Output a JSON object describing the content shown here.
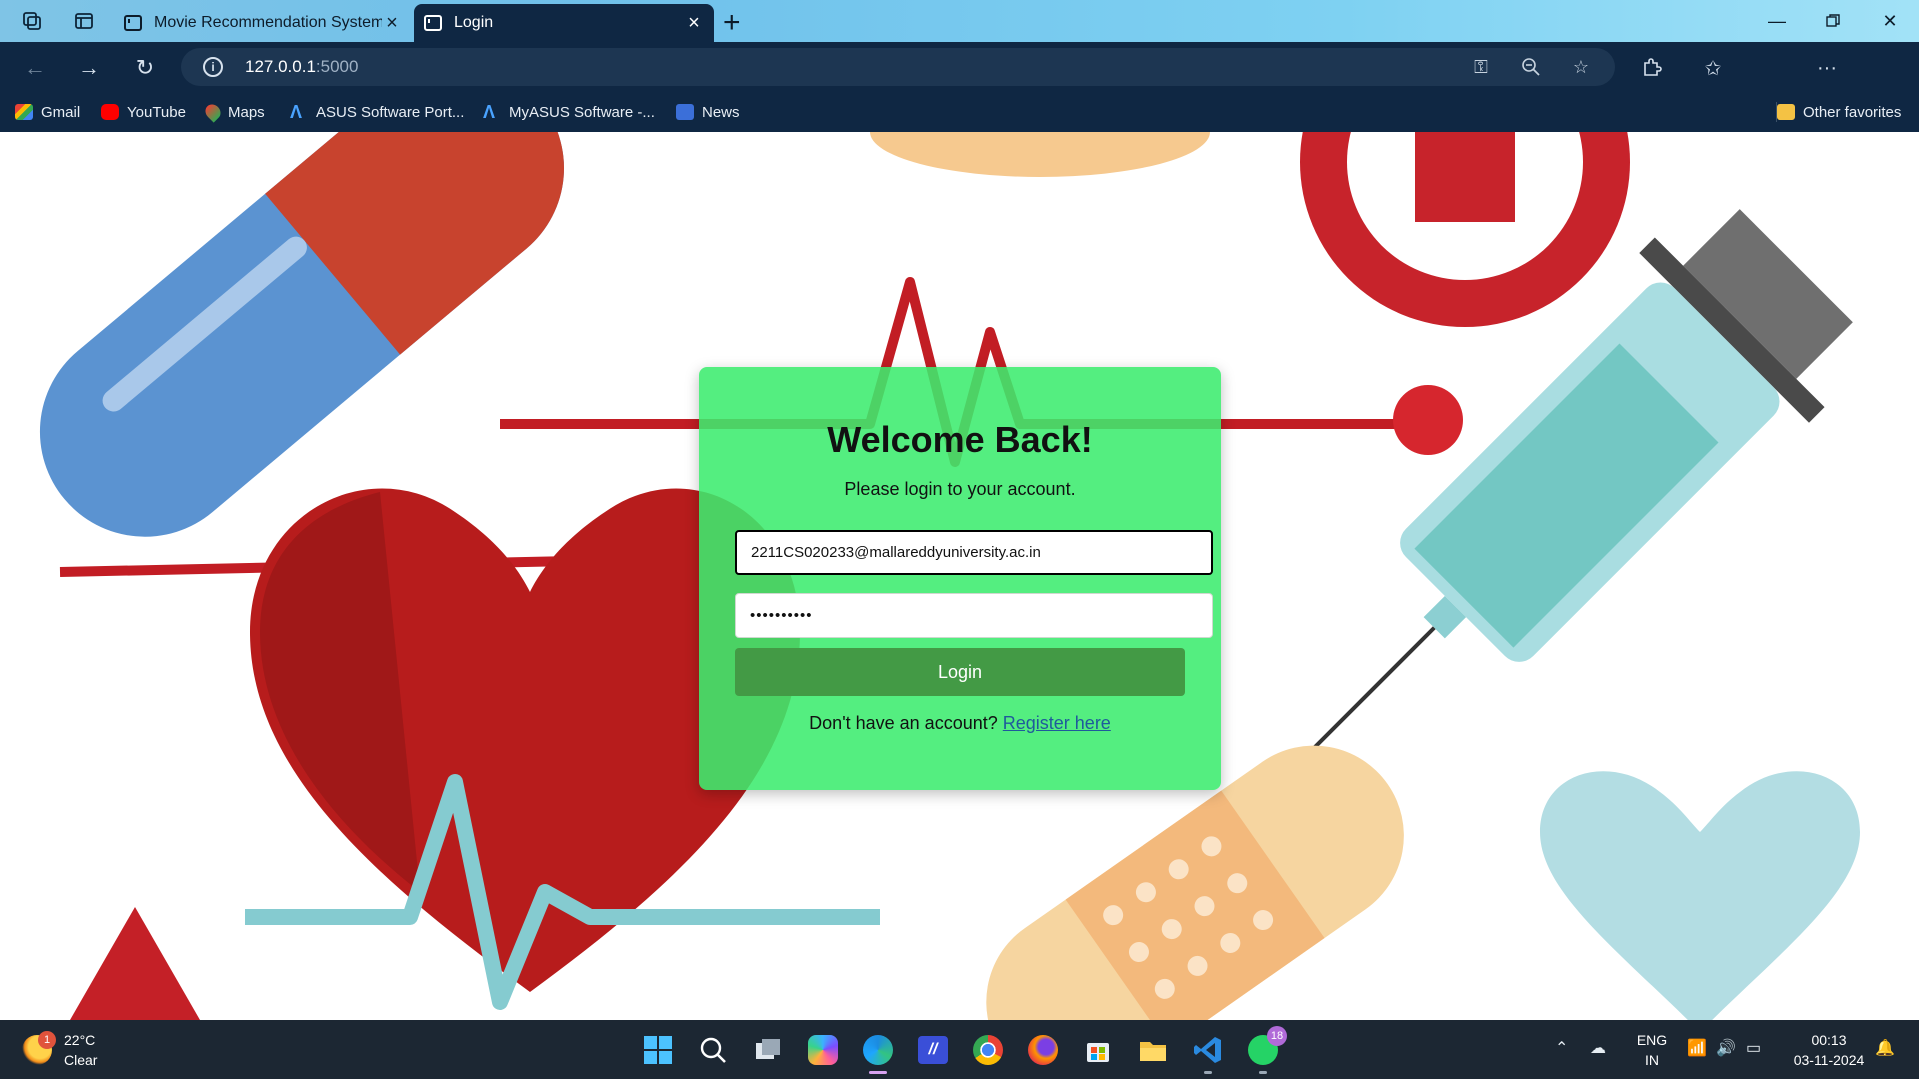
{
  "browser": {
    "tabs": [
      {
        "title": "Movie Recommendation System",
        "active": false
      },
      {
        "title": "Login",
        "active": true
      }
    ],
    "address": {
      "host": "127.0.0.1",
      "port": ":5000"
    },
    "bookmarks": [
      {
        "label": "Gmail",
        "icon": "gmail-icon"
      },
      {
        "label": "YouTube",
        "icon": "youtube-icon"
      },
      {
        "label": "Maps",
        "icon": "maps-icon"
      },
      {
        "label": "ASUS Software Port...",
        "icon": "asus-icon"
      },
      {
        "label": "MyASUS Software -...",
        "icon": "myasus-icon"
      },
      {
        "label": "News",
        "icon": "news-icon"
      }
    ],
    "other_favorites": "Other favorites"
  },
  "login": {
    "title": "Welcome Back!",
    "subtitle": "Please login to your account.",
    "email_value": "2211CS020233@mallareddyuniversity.ac.in",
    "password_value": "••••••••••",
    "login_button": "Login",
    "register_prompt": "Don't have an account?",
    "register_link": "Register here"
  },
  "taskbar": {
    "weather": {
      "temp": "22°C",
      "condition": "Clear",
      "badge": "1"
    },
    "whatsapp_badge": "18",
    "language": {
      "line1": "ENG",
      "line2": "IN"
    },
    "clock": {
      "time": "00:13",
      "date": "03-11-2024"
    }
  },
  "colors": {
    "card": "#3cec6e",
    "login_button": "#439a45",
    "link": "#1f5a9c",
    "chrome_dark": "#0f2743"
  }
}
